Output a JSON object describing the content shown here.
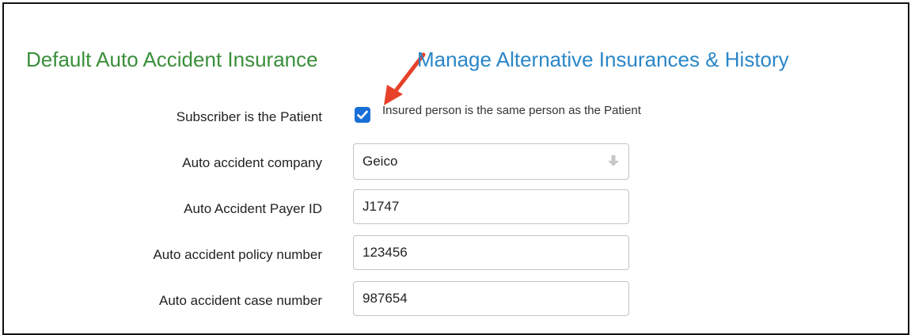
{
  "header": {
    "default_title": "Default Auto Accident Insurance",
    "manage_link": "Manage Alternative Insurances & History"
  },
  "subscriber": {
    "label": "Subscriber is the Patient",
    "checkbox_checked": true,
    "checkbox_label": "Insured person is the same person as the Patient"
  },
  "company": {
    "label": "Auto accident company",
    "value": "Geico"
  },
  "payer_id": {
    "label": "Auto Accident Payer ID",
    "value": "J1747"
  },
  "policy_number": {
    "label": "Auto accident policy number",
    "value": "123456"
  },
  "case_number": {
    "label": "Auto accident case number",
    "value": "987654"
  },
  "colors": {
    "default_title": "#3a8f3a",
    "manage_link": "#2a86c8",
    "checkbox": "#1a6fd6",
    "arrow": "#e8412b"
  },
  "icons": {
    "annotation": "red-arrow-icon",
    "select": "down-arrow-icon",
    "check": "checkmark-icon"
  }
}
